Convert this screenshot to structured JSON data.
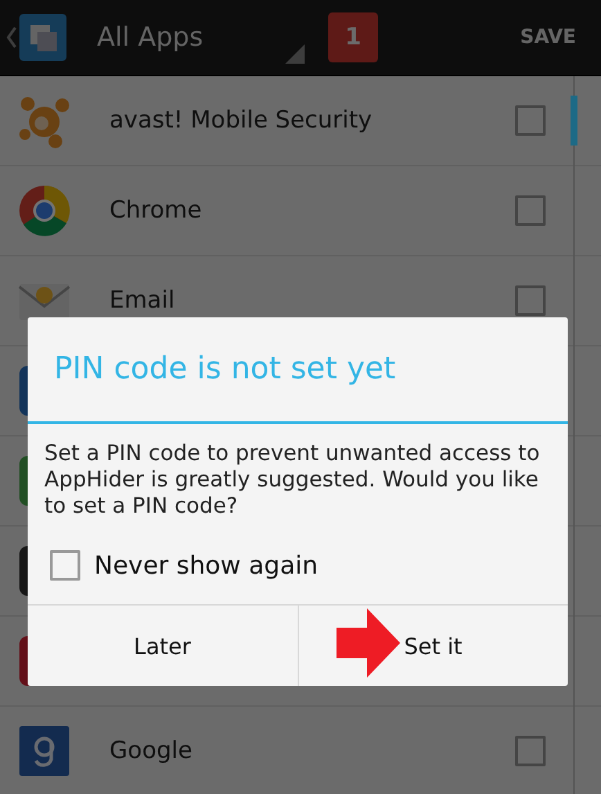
{
  "action_bar": {
    "filter": "All Apps",
    "badge": "1",
    "save": "SAVE"
  },
  "apps": [
    {
      "kind": "avast",
      "label": "avast! Mobile Security",
      "checked": false
    },
    {
      "kind": "chrome",
      "label": "Chrome",
      "checked": false
    },
    {
      "kind": "email",
      "label": "Email",
      "checked": false
    },
    {
      "kind": "covered",
      "color": "#13345a"
    },
    {
      "kind": "covered",
      "color": "#224f24"
    },
    {
      "kind": "covered",
      "color": "#171717"
    },
    {
      "kind": "covered",
      "color": "#631019"
    },
    {
      "kind": "google",
      "label": "Google",
      "checked": false
    }
  ],
  "dialog": {
    "title": "PIN code is not set yet",
    "message": "Set a PIN code to prevent unwanted access to AppHider is greatly suggested. Would you like to set a PIN code?",
    "never_show": {
      "label": "Never show again",
      "checked": false
    },
    "buttons": [
      {
        "label": "Later",
        "pointed": false
      },
      {
        "label": "Set it",
        "pointed": true
      }
    ]
  }
}
